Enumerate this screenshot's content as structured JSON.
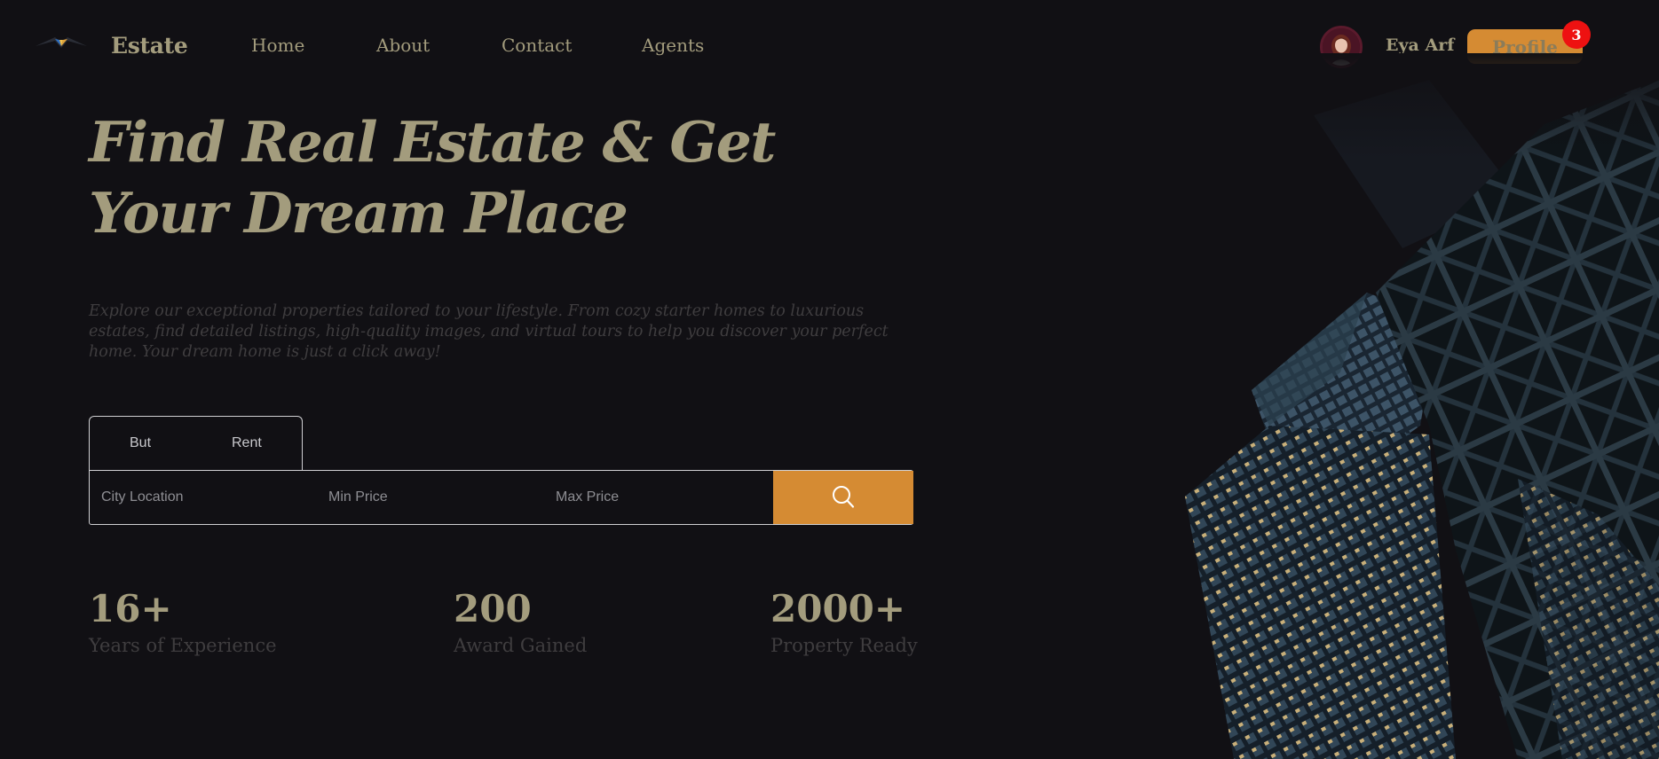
{
  "header": {
    "brand": "Estate",
    "nav": [
      "Home",
      "About",
      "Contact",
      "Agents"
    ],
    "user_name": "Eya Arf",
    "profile_label": "Profile",
    "notification_count": "3"
  },
  "hero": {
    "title": "Find Real Estate & Get Your Dream Place",
    "description": "Explore our exceptional properties tailored to your lifestyle. From cozy starter homes to luxurious estates, find detailed listings, high-quality images, and virtual tours to help you discover your perfect home. Your dream home is just a click away!"
  },
  "search": {
    "tabs": [
      "But",
      "Rent"
    ],
    "city_placeholder": "City Location",
    "min_placeholder": "Min Price",
    "max_placeholder": "Max Price"
  },
  "stats": [
    {
      "value": "16+",
      "label": "Years of Experience"
    },
    {
      "value": "200",
      "label": "Award Gained"
    },
    {
      "value": "2000+",
      "label": "Property Ready"
    }
  ],
  "colors": {
    "background": "#111014",
    "accent": "#d58b33",
    "text": "#a39c7d",
    "badge": "#ee1111"
  },
  "icons": [
    "logo-icon",
    "avatar-image",
    "search-icon",
    "building-image"
  ]
}
